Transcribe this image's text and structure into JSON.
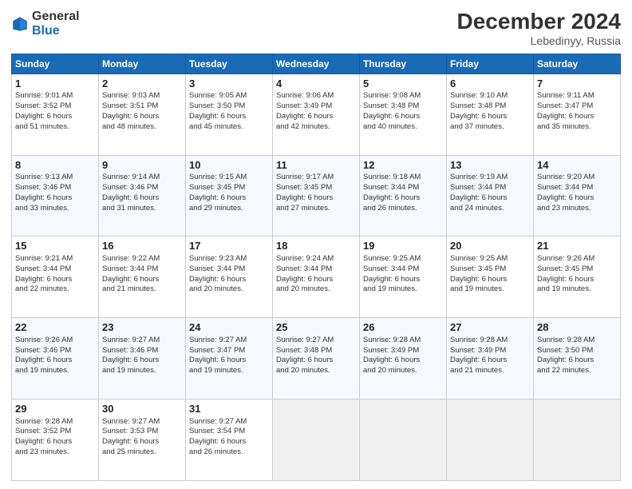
{
  "header": {
    "logo_general": "General",
    "logo_blue": "Blue",
    "title": "December 2024",
    "subtitle": "Lebedinyy, Russia"
  },
  "weekdays": [
    "Sunday",
    "Monday",
    "Tuesday",
    "Wednesday",
    "Thursday",
    "Friday",
    "Saturday"
  ],
  "weeks": [
    [
      {
        "day": "1",
        "info": "Sunrise: 9:01 AM\nSunset: 3:52 PM\nDaylight: 6 hours\nand 51 minutes."
      },
      {
        "day": "2",
        "info": "Sunrise: 9:03 AM\nSunset: 3:51 PM\nDaylight: 6 hours\nand 48 minutes."
      },
      {
        "day": "3",
        "info": "Sunrise: 9:05 AM\nSunset: 3:50 PM\nDaylight: 6 hours\nand 45 minutes."
      },
      {
        "day": "4",
        "info": "Sunrise: 9:06 AM\nSunset: 3:49 PM\nDaylight: 6 hours\nand 42 minutes."
      },
      {
        "day": "5",
        "info": "Sunrise: 9:08 AM\nSunset: 3:48 PM\nDaylight: 6 hours\nand 40 minutes."
      },
      {
        "day": "6",
        "info": "Sunrise: 9:10 AM\nSunset: 3:48 PM\nDaylight: 6 hours\nand 37 minutes."
      },
      {
        "day": "7",
        "info": "Sunrise: 9:11 AM\nSunset: 3:47 PM\nDaylight: 6 hours\nand 35 minutes."
      }
    ],
    [
      {
        "day": "8",
        "info": "Sunrise: 9:13 AM\nSunset: 3:46 PM\nDaylight: 6 hours\nand 33 minutes."
      },
      {
        "day": "9",
        "info": "Sunrise: 9:14 AM\nSunset: 3:46 PM\nDaylight: 6 hours\nand 31 minutes."
      },
      {
        "day": "10",
        "info": "Sunrise: 9:15 AM\nSunset: 3:45 PM\nDaylight: 6 hours\nand 29 minutes."
      },
      {
        "day": "11",
        "info": "Sunrise: 9:17 AM\nSunset: 3:45 PM\nDaylight: 6 hours\nand 27 minutes."
      },
      {
        "day": "12",
        "info": "Sunrise: 9:18 AM\nSunset: 3:44 PM\nDaylight: 6 hours\nand 26 minutes."
      },
      {
        "day": "13",
        "info": "Sunrise: 9:19 AM\nSunset: 3:44 PM\nDaylight: 6 hours\nand 24 minutes."
      },
      {
        "day": "14",
        "info": "Sunrise: 9:20 AM\nSunset: 3:44 PM\nDaylight: 6 hours\nand 23 minutes."
      }
    ],
    [
      {
        "day": "15",
        "info": "Sunrise: 9:21 AM\nSunset: 3:44 PM\nDaylight: 6 hours\nand 22 minutes."
      },
      {
        "day": "16",
        "info": "Sunrise: 9:22 AM\nSunset: 3:44 PM\nDaylight: 6 hours\nand 21 minutes."
      },
      {
        "day": "17",
        "info": "Sunrise: 9:23 AM\nSunset: 3:44 PM\nDaylight: 6 hours\nand 20 minutes."
      },
      {
        "day": "18",
        "info": "Sunrise: 9:24 AM\nSunset: 3:44 PM\nDaylight: 6 hours\nand 20 minutes."
      },
      {
        "day": "19",
        "info": "Sunrise: 9:25 AM\nSunset: 3:44 PM\nDaylight: 6 hours\nand 19 minutes."
      },
      {
        "day": "20",
        "info": "Sunrise: 9:25 AM\nSunset: 3:45 PM\nDaylight: 6 hours\nand 19 minutes."
      },
      {
        "day": "21",
        "info": "Sunrise: 9:26 AM\nSunset: 3:45 PM\nDaylight: 6 hours\nand 19 minutes."
      }
    ],
    [
      {
        "day": "22",
        "info": "Sunrise: 9:26 AM\nSunset: 3:46 PM\nDaylight: 6 hours\nand 19 minutes."
      },
      {
        "day": "23",
        "info": "Sunrise: 9:27 AM\nSunset: 3:46 PM\nDaylight: 6 hours\nand 19 minutes."
      },
      {
        "day": "24",
        "info": "Sunrise: 9:27 AM\nSunset: 3:47 PM\nDaylight: 6 hours\nand 19 minutes."
      },
      {
        "day": "25",
        "info": "Sunrise: 9:27 AM\nSunset: 3:48 PM\nDaylight: 6 hours\nand 20 minutes."
      },
      {
        "day": "26",
        "info": "Sunrise: 9:28 AM\nSunset: 3:49 PM\nDaylight: 6 hours\nand 20 minutes."
      },
      {
        "day": "27",
        "info": "Sunrise: 9:28 AM\nSunset: 3:49 PM\nDaylight: 6 hours\nand 21 minutes."
      },
      {
        "day": "28",
        "info": "Sunrise: 9:28 AM\nSunset: 3:50 PM\nDaylight: 6 hours\nand 22 minutes."
      }
    ],
    [
      {
        "day": "29",
        "info": "Sunrise: 9:28 AM\nSunset: 3:52 PM\nDaylight: 6 hours\nand 23 minutes."
      },
      {
        "day": "30",
        "info": "Sunrise: 9:27 AM\nSunset: 3:53 PM\nDaylight: 6 hours\nand 25 minutes."
      },
      {
        "day": "31",
        "info": "Sunrise: 9:27 AM\nSunset: 3:54 PM\nDaylight: 6 hours\nand 26 minutes."
      },
      {
        "day": "",
        "info": ""
      },
      {
        "day": "",
        "info": ""
      },
      {
        "day": "",
        "info": ""
      },
      {
        "day": "",
        "info": ""
      }
    ]
  ]
}
